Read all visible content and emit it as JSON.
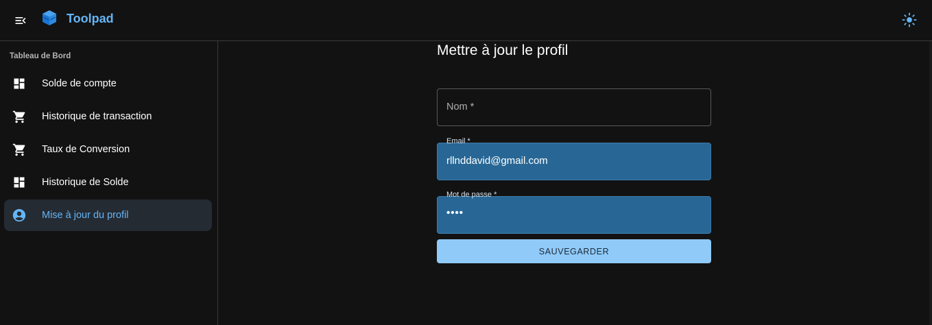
{
  "header": {
    "brand": "Toolpad",
    "menu_icon": "menu-open-icon",
    "theme_icon": "sun-icon",
    "accent_color": "#64b5f6"
  },
  "sidebar": {
    "section_title": "Tableau de Bord",
    "items": [
      {
        "label": "Solde de compte",
        "icon": "dashboard-icon",
        "active": false
      },
      {
        "label": "Historique de transaction",
        "icon": "shopping-cart-icon",
        "active": false
      },
      {
        "label": "Taux de Conversion",
        "icon": "shopping-cart-icon",
        "active": false
      },
      {
        "label": "Historique de Solde",
        "icon": "dashboard-icon",
        "active": false
      },
      {
        "label": "Mise à jour du profil",
        "icon": "account-circle-icon",
        "active": true
      }
    ]
  },
  "main": {
    "title": "Mettre à jour le profil",
    "form": {
      "name": {
        "placeholder": "Nom *",
        "value": ""
      },
      "email": {
        "label": "Email *",
        "value": "rllnddavid@gmail.com"
      },
      "password": {
        "label": "Mot de passe *",
        "value": "••••"
      },
      "submit_label": "SAUVEGARDER"
    }
  }
}
